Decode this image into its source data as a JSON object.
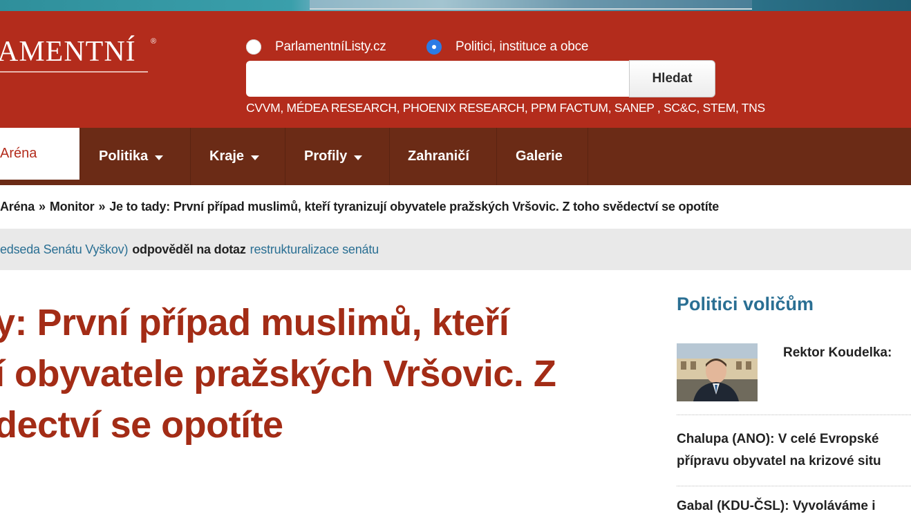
{
  "header": {
    "logo_text": "AMENTNÍ",
    "logo_reg": "®",
    "radio_options": [
      {
        "label": "ParlamentníListy.cz",
        "selected": false
      },
      {
        "label": "Politici, instituce a obce",
        "selected": true
      }
    ],
    "search_value": "",
    "search_button": "Hledat",
    "agencies": "CVVM, MÉDEA RESEARCH, PHOENIX RESEARCH, PPM FACTUM, SANEP , SC&C, STEM, TNS"
  },
  "nav": {
    "items": [
      {
        "label": "Aréna",
        "active": true,
        "dropdown": false
      },
      {
        "label": "Politika",
        "active": false,
        "dropdown": true
      },
      {
        "label": "Kraje",
        "active": false,
        "dropdown": true
      },
      {
        "label": "Profily",
        "active": false,
        "dropdown": true
      },
      {
        "label": "Zahraničí",
        "active": false,
        "dropdown": false
      },
      {
        "label": "Galerie",
        "active": false,
        "dropdown": false
      }
    ]
  },
  "breadcrumb": {
    "items": [
      "Aréna",
      "Monitor",
      "Je to tady: První případ muslimů, kteří tyranizují obyvatele pražských Vršovic. Z toho svědectví se opotíte"
    ],
    "separator": "»"
  },
  "infobar": {
    "who": "edseda Senátu Vyškov)",
    "verb": "odpověděl na dotaz",
    "topic": "restrukturalizace senátu"
  },
  "article": {
    "headline_lines": [
      "y: První případ muslimů, kteří",
      "í obyvatele pražských Vršovic. Z",
      "dectví se opotíte"
    ]
  },
  "sidebar": {
    "title": "Politici voličům",
    "items": [
      {
        "title": "Rektor Koudelka:"
      },
      {
        "lines": [
          "Chalupa (ANO): V celé Evropské",
          "přípravu obyvatel na krizové situ"
        ]
      },
      {
        "title": "Gabal (KDU-ČSL): Vyvoláváme i"
      }
    ]
  },
  "colors": {
    "header_red": "#b32c1c",
    "nav_brown": "#6b2b16",
    "headline_red": "#a32c16",
    "link_blue": "#2a6f93",
    "radio_blue": "#2c7be5"
  }
}
